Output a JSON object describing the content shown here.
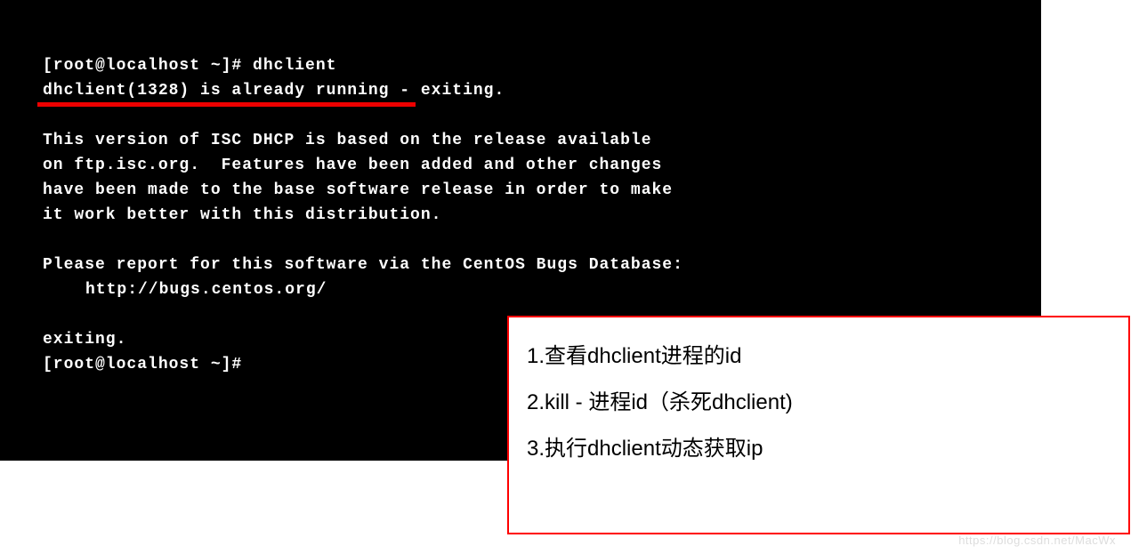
{
  "terminal": {
    "line1": "[root@localhost ~]# dhclient",
    "line2": "dhclient(1328) is already running - exiting.",
    "line3": "This version of ISC DHCP is based on the release available",
    "line4": "on ftp.isc.org.  Features have been added and other changes",
    "line5": "have been made to the base software release in order to make",
    "line6": "it work better with this distribution.",
    "line7": "Please report for this software via the CentOS Bugs Database:",
    "line8": "http://bugs.centos.org/",
    "line9": "exiting.",
    "line10": "[root@localhost ~]#"
  },
  "notes": {
    "item1": "1.查看dhclient进程的id",
    "item2": "2.kill - 进程id（杀死dhclient)",
    "item3": "3.执行dhclient动态获取ip"
  },
  "watermark": "https://blog.csdn.net/MacWx"
}
